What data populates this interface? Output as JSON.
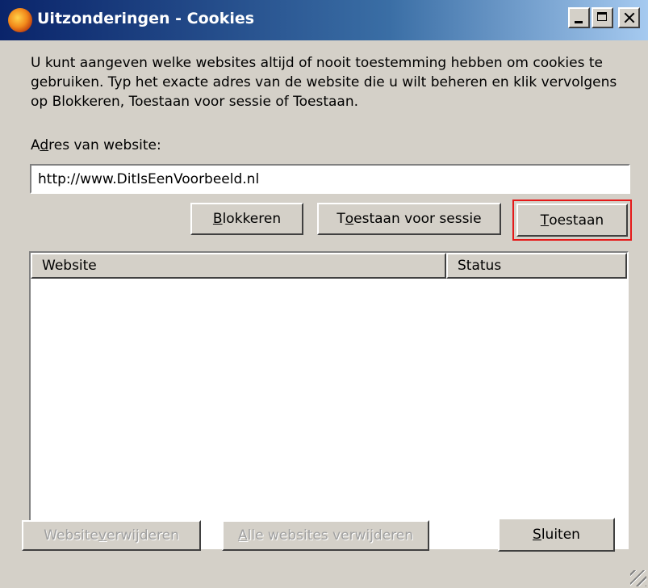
{
  "window": {
    "title": "Uitzonderingen - Cookies",
    "app_icon": "firefox-icon",
    "controls": [
      "minimize-icon",
      "maximize-icon",
      "close-icon"
    ]
  },
  "description": "U kunt aangeven welke websites altijd of nooit toestemming hebben om cookies te gebruiken. Typ het exacte adres van de website die u wilt beheren en klik vervolgens op Blokkeren, Toestaan voor sessie of Toestaan.",
  "address": {
    "label_prefix": "A",
    "label_accel": "d",
    "label_rest": "res van website:",
    "value": "http://www.DitIsEenVoorbeeld.nl"
  },
  "actions": {
    "block": {
      "accel": "B",
      "rest": "lokkeren"
    },
    "session": {
      "pre": "T",
      "accel": "o",
      "rest": "estaan voor sessie"
    },
    "allow": {
      "accel": "T",
      "rest": "oestaan",
      "highlight_color": "#e51919"
    }
  },
  "list": {
    "columns": [
      "Website",
      "Status"
    ],
    "rows": []
  },
  "footer": {
    "remove": {
      "pre": "Website ",
      "accel": "v",
      "rest": "erwijderen",
      "enabled": false
    },
    "remove_all": {
      "accel": "A",
      "rest": "lle websites verwijderen",
      "enabled": false
    },
    "close": {
      "accel": "S",
      "rest": "luiten"
    }
  }
}
